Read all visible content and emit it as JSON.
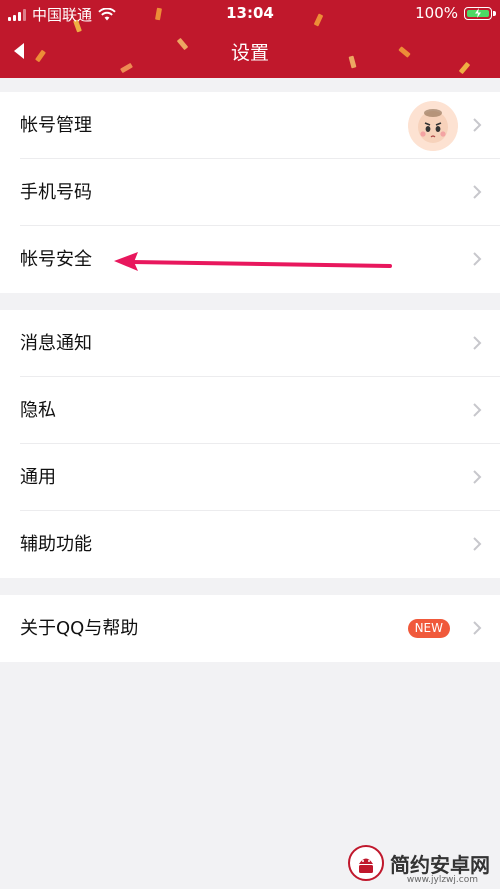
{
  "status_bar": {
    "carrier": "中国联通",
    "time": "13:04",
    "battery_percent": "100%"
  },
  "nav": {
    "title": "设置",
    "back_icon": "back-triangle-icon"
  },
  "groups": [
    {
      "items": [
        {
          "label": "帐号管理",
          "trailing": "avatar"
        },
        {
          "label": "手机号码",
          "trailing": "chevron"
        },
        {
          "label": "帐号安全",
          "trailing": "chevron"
        }
      ]
    },
    {
      "items": [
        {
          "label": "消息通知",
          "trailing": "chevron"
        },
        {
          "label": "隐私",
          "trailing": "chevron"
        },
        {
          "label": "通用",
          "trailing": "chevron"
        },
        {
          "label": "辅助功能",
          "trailing": "chevron"
        }
      ]
    },
    {
      "items": [
        {
          "label": "关于QQ与帮助",
          "trailing": "badge",
          "badge": "NEW"
        }
      ]
    }
  ],
  "watermark": {
    "text": "简约安卓网",
    "url": "www.jylzwj.com"
  },
  "colors": {
    "header_red": "#c0182c",
    "badge_orange": "#f0593b",
    "annotation_arrow": "#e8175d",
    "background": "#f2f2f4"
  }
}
